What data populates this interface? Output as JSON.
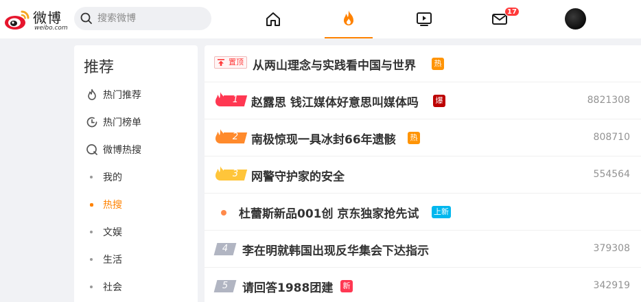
{
  "brand": {
    "name_cn": "微博",
    "name_en": "weibo.com",
    "accent": "#ff8200"
  },
  "search": {
    "placeholder": "搜索微博",
    "icon": "search-icon"
  },
  "nav": {
    "items": [
      {
        "name": "home",
        "icon": "home-icon"
      },
      {
        "name": "hot",
        "icon": "flame-icon",
        "active": true
      },
      {
        "name": "video",
        "icon": "video-icon"
      },
      {
        "name": "messages",
        "icon": "mail-icon",
        "badge": "17"
      }
    ],
    "avatar": "avatar"
  },
  "sidebar": {
    "title": "推荐",
    "items": [
      {
        "label": "热门推荐",
        "icon": "flame-outline-icon"
      },
      {
        "label": "热门榜单",
        "icon": "clock-icon"
      },
      {
        "label": "微博热搜",
        "icon": "search-circle-icon"
      },
      {
        "label": "我的"
      },
      {
        "label": "热搜",
        "active": true
      },
      {
        "label": "文娱"
      },
      {
        "label": "生活"
      },
      {
        "label": "社会"
      }
    ]
  },
  "hot_list": {
    "pinned": {
      "label": "置顶",
      "title": "从两山理念与实践看中国与世界",
      "tag": "热",
      "tag_color": "#ff9406"
    },
    "rows": [
      {
        "rank": "1",
        "title": "赵露思 钱江媒体好意思叫媒体吗",
        "tag": "爆",
        "tag_color": "#bd0000",
        "count": "8821308",
        "rank_color": "#ff3852"
      },
      {
        "rank": "2",
        "title": "南极惊现一具冰封66年遗骸",
        "tag": "热",
        "tag_color": "#ff9406",
        "count": "808710",
        "rank_color": "#ff8a2c"
      },
      {
        "rank": "3",
        "title": "网警守护家的安全",
        "tag": "",
        "count": "554564",
        "rank_color": "#ffc53a"
      },
      {
        "rank": "",
        "title": "杜蕾斯新品001创 京东独家抢先试",
        "tag": "上新",
        "tag_color": "#00b7ee",
        "count": ""
      },
      {
        "rank": "4",
        "title": "李在明就韩国出现反华集会下达指示",
        "tag": "",
        "count": "379308"
      },
      {
        "rank": "5",
        "title": "请回答1988团建",
        "tag": "新",
        "tag_color": "#ff3852",
        "count": "342919"
      }
    ]
  }
}
